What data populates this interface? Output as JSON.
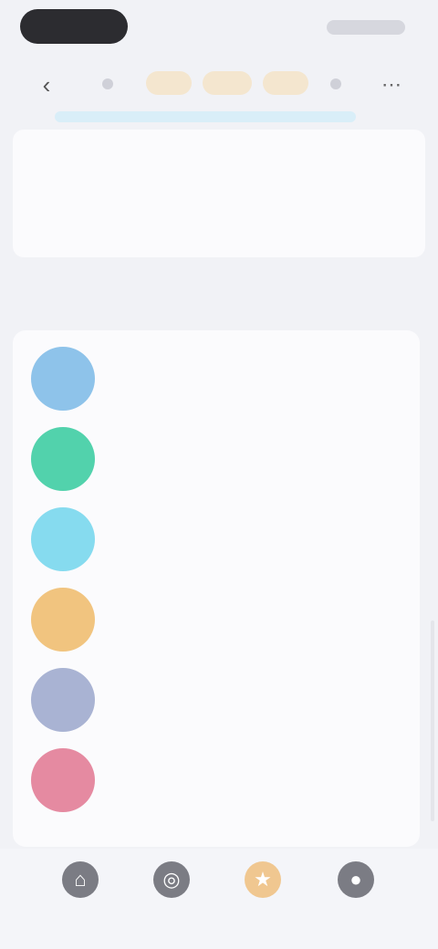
{
  "status_bar": {
    "time": "",
    "right_indicators": ""
  },
  "nav": {
    "back_icon": "chevron-left-icon",
    "tabs": [
      {
        "label": ""
      },
      {
        "label": ""
      },
      {
        "label": ""
      }
    ],
    "more_icon": "more-icon"
  },
  "top_card": {
    "label": ""
  },
  "section": {
    "title": ""
  },
  "items": [
    {
      "title": "",
      "subtitle": "",
      "color": "#8ec3ea"
    },
    {
      "title": "",
      "subtitle": "",
      "color": "#52d2ac"
    },
    {
      "title": "",
      "subtitle": "",
      "color": "#86dbef"
    },
    {
      "title": "",
      "subtitle": "",
      "color": "#f1c47f"
    },
    {
      "title": "",
      "subtitle": "",
      "color": "#a9b3d3"
    },
    {
      "title": "",
      "subtitle": "",
      "color": "#e58aa1"
    }
  ],
  "bottom_nav": [
    {
      "label": "",
      "icon": "home-icon",
      "color": "#7b7c84"
    },
    {
      "label": "",
      "icon": "discover-icon",
      "color": "#7b7c84"
    },
    {
      "label": "",
      "icon": "star-icon",
      "color": "#f0c790"
    },
    {
      "label": "",
      "icon": "profile-icon",
      "color": "#7b7c84"
    }
  ]
}
